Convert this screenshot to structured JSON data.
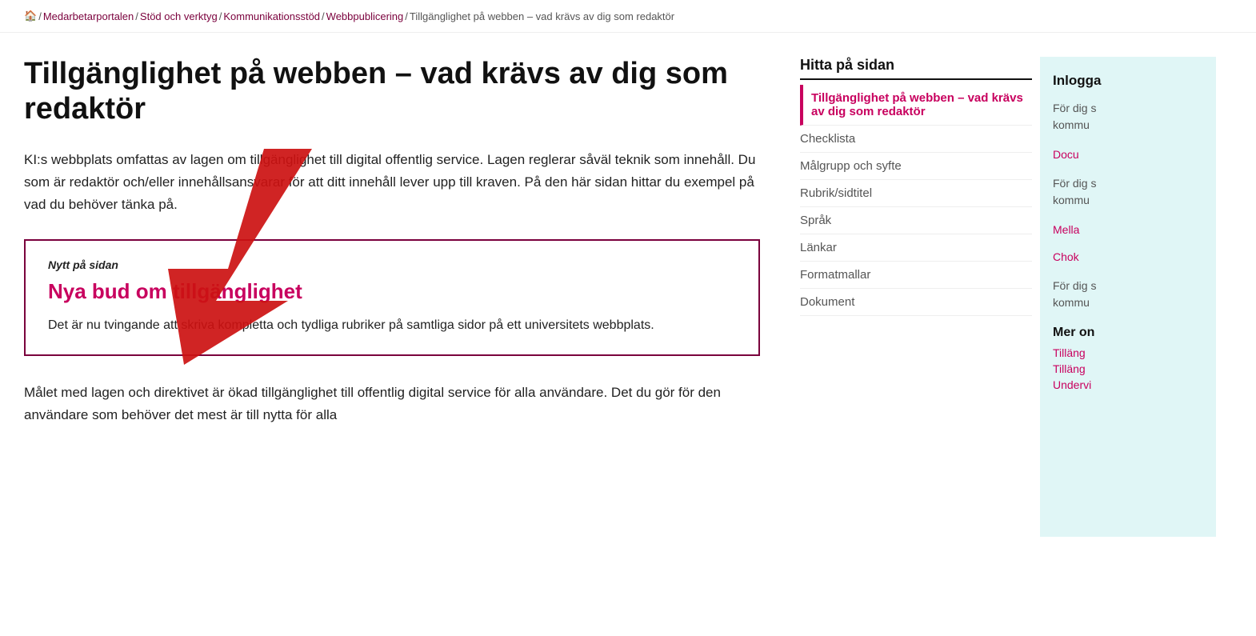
{
  "breadcrumb": {
    "home_icon": "🏠",
    "items": [
      {
        "label": "Medarbetarportalen",
        "href": "#"
      },
      {
        "label": "Stöd och verktyg",
        "href": "#"
      },
      {
        "label": "Kommunikationsstöd",
        "href": "#"
      },
      {
        "label": "Webbpublicering",
        "href": "#"
      },
      {
        "label": "Tillgänglighet på webben – vad krävs av dig som redaktör",
        "href": "#"
      }
    ]
  },
  "page": {
    "title": "Tillgänglighet på webben – vad krävs av dig som redaktör",
    "intro": "KI:s webbplats omfattas av lagen om tillgänglighet till digital offentlig service. Lagen reglerar såväl teknik som innehåll. Du som är redaktör och/eller innehållsansvarar för att ditt innehåll lever upp till kraven. På den här sidan hittar du exempel på vad du behöver tänka på.",
    "news_label": "Nytt på sidan",
    "news_title": "Nya bud om tillgänglighet",
    "news_body": "Det är nu tvingande att skriva kompletta och tydliga rubriker på samtliga sidor på ett universitets webbplats.",
    "bottom_text": "Målet med lagen och direktivet är ökad tillgänglighet till offentlig digital service för alla användare. Det du gör för den användare som behöver det mest är till nytta för alla"
  },
  "sidebar": {
    "section_title": "Hitta på sidan",
    "nav_items": [
      {
        "label": "Tillgänglighet på webben – vad krävs av dig som redaktör",
        "active": true
      },
      {
        "label": "Checklista",
        "active": false
      },
      {
        "label": "Målgrupp och syfte",
        "active": false
      },
      {
        "label": "Rubrik/sidtitel",
        "active": false
      },
      {
        "label": "Språk",
        "active": false
      },
      {
        "label": "Länkar",
        "active": false
      },
      {
        "label": "Formatmallar",
        "active": false
      },
      {
        "label": "Dokument",
        "active": false
      }
    ]
  },
  "right_panel": {
    "title": "Inlogga",
    "sections": [
      {
        "text": "För dig som kommunr",
        "link": null
      },
      {
        "text": "Docu",
        "link": "#"
      },
      {
        "text": "För dig som kommunr",
        "link": null
      },
      {
        "text": "Mella",
        "link": "#"
      },
      {
        "text": "Chok",
        "link": "#"
      },
      {
        "text": "För dig som kommunr",
        "link": null
      }
    ],
    "more_title": "Mer on",
    "more_links": [
      {
        "label": "Tilläng",
        "href": "#"
      },
      {
        "label": "Tilläng",
        "href": "#"
      },
      {
        "label": "Undervi",
        "href": "#"
      }
    ]
  }
}
